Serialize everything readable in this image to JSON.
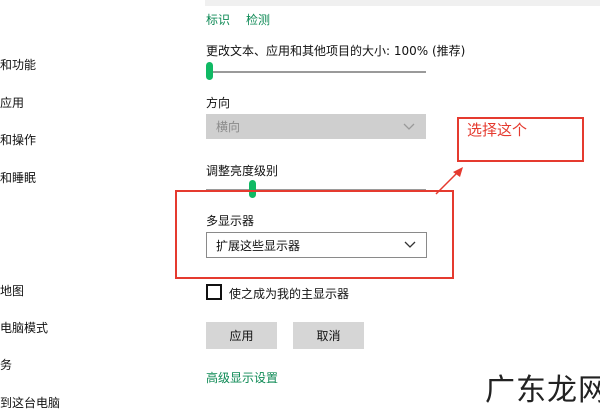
{
  "top_links": {
    "identify": "标识",
    "detect": "检测"
  },
  "sidebar": {
    "items": [
      {
        "label": "和功能"
      },
      {
        "label": "应用"
      },
      {
        "label": "和操作"
      },
      {
        "label": "和睡眠"
      },
      {
        "label": "地图"
      },
      {
        "label": "电脑模式"
      },
      {
        "label": "务"
      },
      {
        "label": "到这台电脑"
      }
    ]
  },
  "scale": {
    "label": "更改文本、应用和其他项目的大小: 100% (推荐)",
    "value_percent": 0
  },
  "orientation": {
    "label": "方向",
    "selected": "横向",
    "enabled": false
  },
  "brightness": {
    "label": "调整亮度级别",
    "value_percent": 20
  },
  "multi_display": {
    "label": "多显示器",
    "selected": "扩展这些显示器"
  },
  "main_display_checkbox": {
    "label": "使之成为我的主显示器",
    "checked": false
  },
  "buttons": {
    "apply": "应用",
    "cancel": "取消"
  },
  "advanced_link": "高级显示设置",
  "annotation": {
    "text": "选择这个"
  },
  "watermark": {
    "text": "广东龙网"
  },
  "colors": {
    "accent": "#10b964",
    "link": "#0e8a55",
    "annotation": "#e53a2f"
  }
}
